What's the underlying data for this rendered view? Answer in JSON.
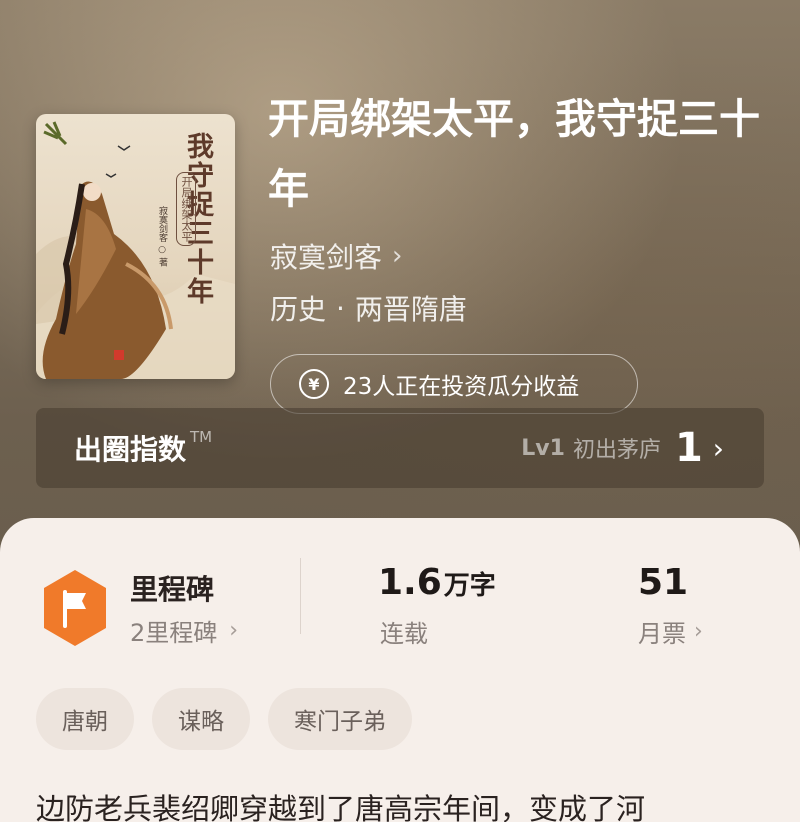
{
  "book": {
    "title": "开局绑架太平，我守捉三十年",
    "author": "寂寞剑客",
    "category": "历史",
    "subcategory": "两晋隋唐",
    "separator": "·"
  },
  "cover": {
    "title": "我守捉三十年",
    "subtitle": "开局绑架太平",
    "author": "寂寞剑客 ○ 著"
  },
  "invest": {
    "text": "23人正在投资瓜分收益",
    "icon": "yen-coin-icon"
  },
  "circle_index": {
    "title": "出圈指数",
    "tm": "TM",
    "level_badge": "Lv1",
    "level_name": "初出茅庐",
    "level_number": "1"
  },
  "stats": {
    "milestone_title": "里程碑",
    "milestone_count": "2里程碑",
    "word_count_value": "1.6",
    "word_count_unit": "万字",
    "word_count_label": "连载",
    "monthly_votes_value": "51",
    "monthly_votes_label": "月票"
  },
  "tags": [
    "唐朝",
    "谋略",
    "寒门子弟"
  ],
  "description": "边防老兵裴绍卿穿越到了唐高宗年间，变成了河",
  "colors": {
    "milestone_orange": "#f07a2a",
    "panel_bg": "#f6efea"
  }
}
